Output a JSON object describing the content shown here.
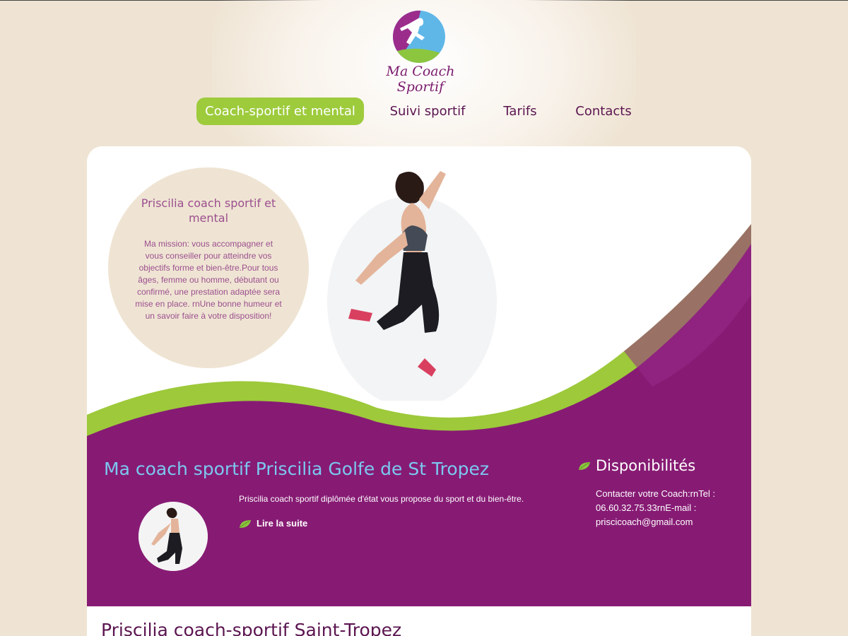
{
  "brand": {
    "logo_text": "Ma Coach Sportif"
  },
  "nav": {
    "items": [
      {
        "label": "Coach-sportif et mental",
        "active": true
      },
      {
        "label": "Suivi sportif",
        "active": false
      },
      {
        "label": "Tarifs",
        "active": false
      },
      {
        "label": "Contacts",
        "active": false
      }
    ]
  },
  "intro": {
    "title": "Priscilia coach sportif et mental",
    "text": "Ma mission: vous accompagner et vous conseiller pour atteindre vos objectifs forme et bien-être.Pour tous âges, femme ou homme, débutant ou confirmé, une prestation adaptée sera mise en place. rnUne bonne humeur et un savoir faire à votre disposition!"
  },
  "main": {
    "title": "Ma coach sportif Priscilia Golfe de St Tropez",
    "lead": "Priscilia coach sportif diplômée d'état vous propose du sport et du bien-être.",
    "read_more": "Lire la suite"
  },
  "sidebar": {
    "title": "Disponibilités",
    "text": "Contacter votre Coach:rnTel : 06.60.32.75.33rnE-mail : priscicoach@gmail.com"
  },
  "section": {
    "title": "Priscilia coach-sportif Saint-Tropez"
  },
  "colors": {
    "background": "#efe4d3",
    "accent_green": "#9dcb3c",
    "purple": "#871b74",
    "title_blue": "#7cc8f0",
    "nav_text": "#5b1550"
  }
}
